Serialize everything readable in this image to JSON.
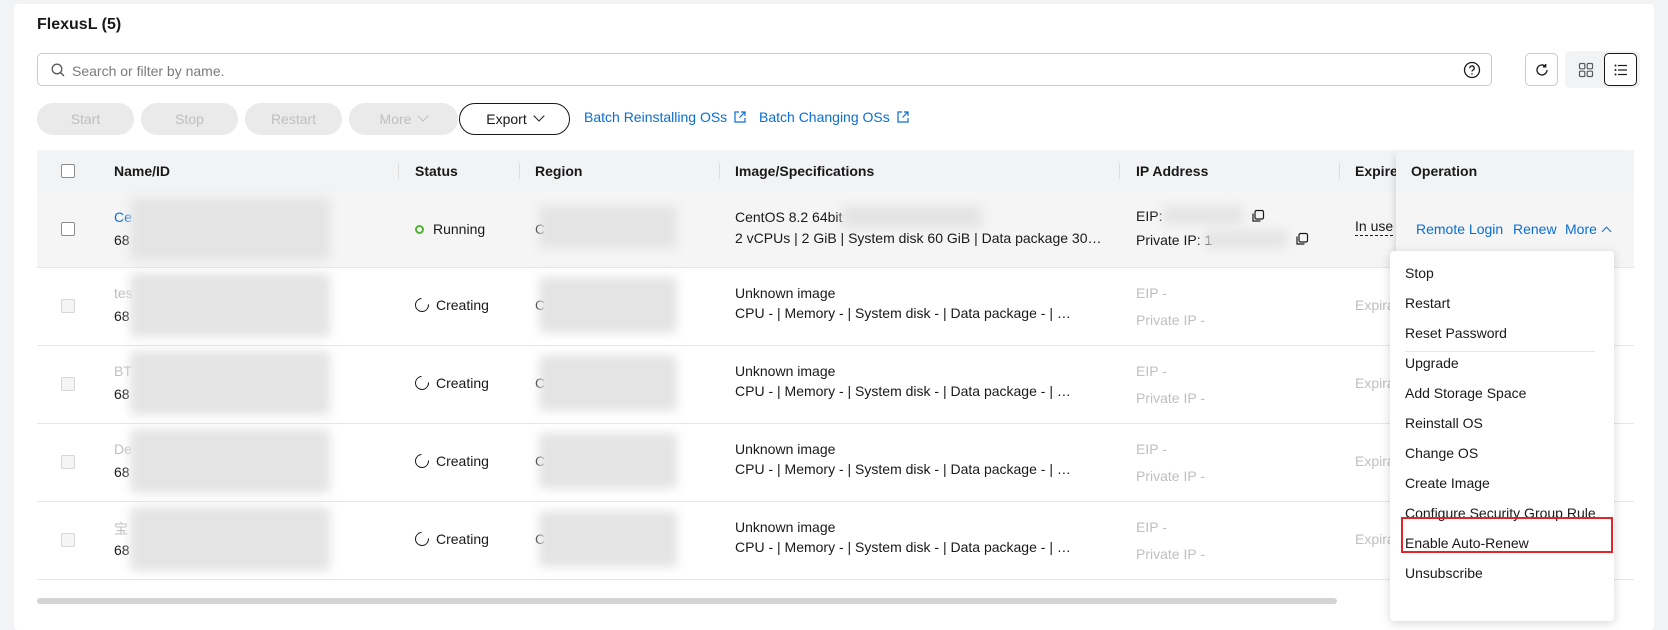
{
  "section": {
    "title": "FlexusL (5)"
  },
  "search": {
    "placeholder": "Search or filter by name."
  },
  "toolbar": {
    "start": "Start",
    "stop": "Stop",
    "restart": "Restart",
    "more": "More",
    "export": "Export",
    "batch_reinstall": "Batch Reinstalling OSs",
    "batch_change": "Batch Changing OSs"
  },
  "columns": {
    "name": "Name/ID",
    "status": "Status",
    "region": "Region",
    "image": "Image/Specifications",
    "ip": "IP Address",
    "expire": "Expire",
    "operation": "Operation"
  },
  "rows": [
    {
      "name": "Ce",
      "id": "68",
      "status": "Running",
      "region": "C",
      "image": "CentOS 8.2 64bit",
      "specs": "2 vCPUs | 2 GiB | System disk 60 GiB | Data package 30…",
      "eip": "EIP:",
      "private_ip": "Private IP: 1",
      "expire": "In use"
    },
    {
      "name": "tes",
      "id": "68",
      "status": "Creating",
      "region": "C",
      "image": "Unknown image",
      "specs": "CPU -  |  Memory -  |  System disk -  |  Data package -  |  …",
      "eip": "EIP -",
      "private_ip": "Private IP -",
      "expire": "Expira"
    },
    {
      "name": "BT",
      "id": "68",
      "status": "Creating",
      "region": "C",
      "image": "Unknown image",
      "specs": "CPU -  |  Memory -  |  System disk -  |  Data package -  |  …",
      "eip": "EIP -",
      "private_ip": "Private IP -",
      "expire": "Expira"
    },
    {
      "name": "De",
      "id": "68",
      "status": "Creating",
      "region": "C",
      "image": "Unknown image",
      "specs": "CPU -  |  Memory -  |  System disk -  |  Data package -  |  …",
      "eip": "EIP -",
      "private_ip": "Private IP -",
      "expire": "Expira"
    },
    {
      "name": "宝",
      "id": "68",
      "status": "Creating",
      "region": "C",
      "image": "Unknown image",
      "specs": "CPU -  |  Memory -  |  System disk -  |  Data package -  |  …",
      "eip": "EIP -",
      "private_ip": "Private IP -",
      "expire": "Expira"
    }
  ],
  "operation": {
    "remote_login": "Remote Login",
    "renew": "Renew",
    "more": "More"
  },
  "menu": {
    "items": [
      "Stop",
      "Restart",
      "Reset Password",
      "Upgrade",
      "Add Storage Space",
      "Reinstall OS",
      "Change OS",
      "Create Image",
      "Configure Security Group Rule",
      "Enable Auto-Renew",
      "Unsubscribe"
    ],
    "highlighted": "Configure Security Group Rule"
  },
  "colors": {
    "link": "#0a6ed5",
    "running": "#50b233",
    "highlight_border": "#e0262b"
  },
  "icons": [
    "search-icon",
    "help-icon",
    "refresh-icon",
    "grid-view-icon",
    "list-view-icon",
    "external-link-icon",
    "copy-icon",
    "chevron-down-icon",
    "chevron-up-icon",
    "spinner-icon"
  ]
}
